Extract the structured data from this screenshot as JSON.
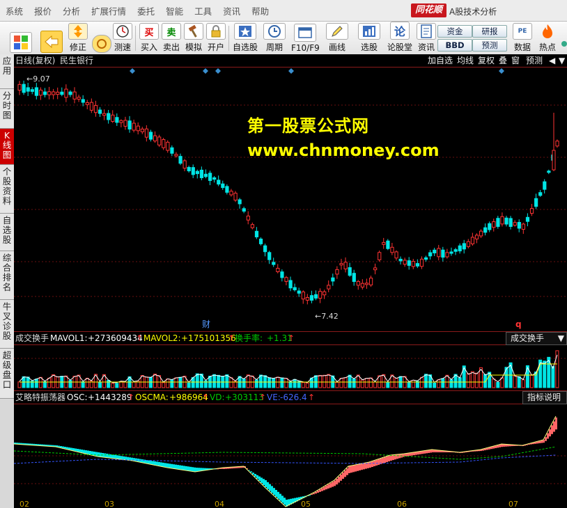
{
  "menubar": {
    "items": [
      "系统",
      "报价",
      "分析",
      "扩展行情",
      "委托",
      "智能",
      "工具",
      "资讯",
      "帮助"
    ],
    "brand": "同花顺",
    "app_title": "A股技术分析"
  },
  "toolbar": {
    "buttons": [
      {
        "label": "",
        "icon": "windows-icon"
      },
      {
        "label": "",
        "icon": "back-arrow-icon"
      },
      {
        "label": "修正",
        "icon": "arrows-updown-icon"
      },
      {
        "label": "测速",
        "icon": "speedometer-icon"
      },
      {
        "label": "买入",
        "icon": "buy-icon"
      },
      {
        "label": "卖出",
        "icon": "sell-icon"
      },
      {
        "label": "模拟",
        "icon": "hammer-icon"
      },
      {
        "label": "开户",
        "icon": "lock-icon"
      },
      {
        "label": "自选股",
        "icon": "star-icon"
      },
      {
        "label": "周期",
        "icon": "clock-icon"
      },
      {
        "label": "F10/F9",
        "icon": "window-icon"
      },
      {
        "label": "画线",
        "icon": "pen-icon"
      },
      {
        "label": "选股",
        "icon": "select-stock-icon"
      },
      {
        "label": "论股堂",
        "icon": "chat-icon"
      },
      {
        "label": "资讯",
        "icon": "news-icon"
      },
      {
        "label": "数据",
        "icon": "pe-icon"
      },
      {
        "label": "热点",
        "icon": "flame-icon"
      }
    ],
    "small_buttons": [
      "资金",
      "研报",
      "BBD",
      "预测"
    ],
    "buy_char": "买",
    "sell_char": "卖",
    "lun_char": "论",
    "pe_text": "PE"
  },
  "sidebar": {
    "items": [
      "应用",
      "分时图",
      "K线图",
      "个股资料",
      "自选股",
      "综合排名",
      "牛叉诊股",
      "超级盘口"
    ]
  },
  "kline": {
    "title": "日线(复权)",
    "stock_name": "民生银行",
    "tabs": [
      "加自选",
      "均线",
      "复权",
      "叠",
      "窗",
      "预测"
    ],
    "high_label": "9.07",
    "low_label": "7.42",
    "marker_cai": "财",
    "marker_q": "q"
  },
  "watermark": {
    "line1": "第一股票公式网",
    "line2": "www.chnmoney.com"
  },
  "volume_panel": {
    "name": "成交换手",
    "mavol1_label": "MAVOL1:",
    "mavol1_value": "+273609434",
    "mavol2_label": "MAVOL2:",
    "mavol2_value": "+175101356",
    "turnover_label": "换手率:",
    "turnover_value": "+1.31",
    "dropdown": "成交换手"
  },
  "osc_panel": {
    "name": "艾略特振荡器",
    "osc_label": "OSC:",
    "osc_value": "+1443289",
    "oscma_label": "OSCMA:",
    "oscma_value": "+986964",
    "vd_label": "VD:",
    "vd_value": "+303113",
    "ve_label": "VE:",
    "ve_value": "-626.4",
    "button": "指标说明"
  },
  "x_axis": {
    "labels": [
      "02",
      "03",
      "04",
      "05",
      "06",
      "07"
    ]
  },
  "colors": {
    "up": "#ff3333",
    "down": "#00e5e5",
    "watermark": "#ffff00",
    "mavol1": "#ffffff",
    "mavol2": "#ffff00",
    "turnover": "#00cc00",
    "vd": "#00cc00",
    "ve": "#3355ff"
  }
}
